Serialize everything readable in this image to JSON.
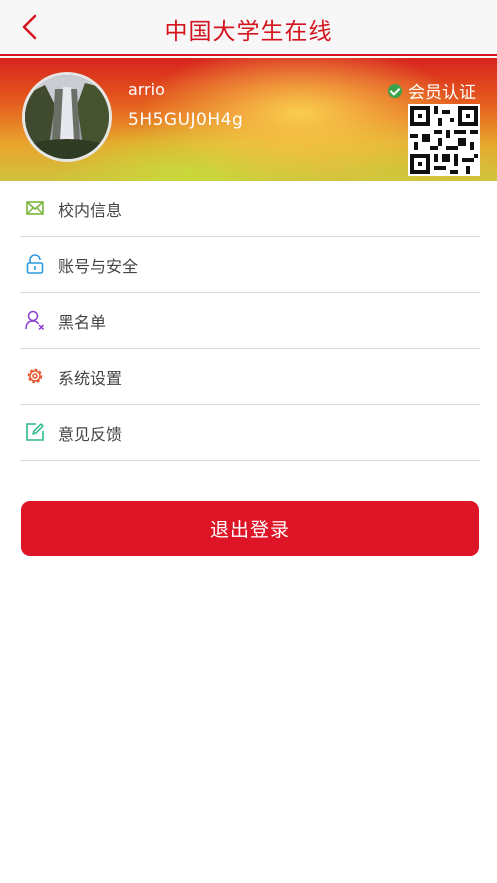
{
  "header": {
    "title": "中国大学生在线"
  },
  "profile": {
    "username": "arrio",
    "user_id": "5H5GUJ0H4g",
    "member_label": "会员认证"
  },
  "menu": [
    {
      "label": "校内信息",
      "icon": "mail-icon",
      "color": "#7ab53d"
    },
    {
      "label": "账号与安全",
      "icon": "lock-icon",
      "color": "#2c9ce0"
    },
    {
      "label": "黑名单",
      "icon": "blacklist-user-icon",
      "color": "#8a3fd1"
    },
    {
      "label": "系统设置",
      "icon": "gear-icon",
      "color": "#e8572b"
    },
    {
      "label": "意见反馈",
      "icon": "edit-icon",
      "color": "#2bb98a"
    }
  ],
  "logout_label": "退出登录",
  "colors": {
    "accent": "#d4151f",
    "button": "#de1527"
  }
}
